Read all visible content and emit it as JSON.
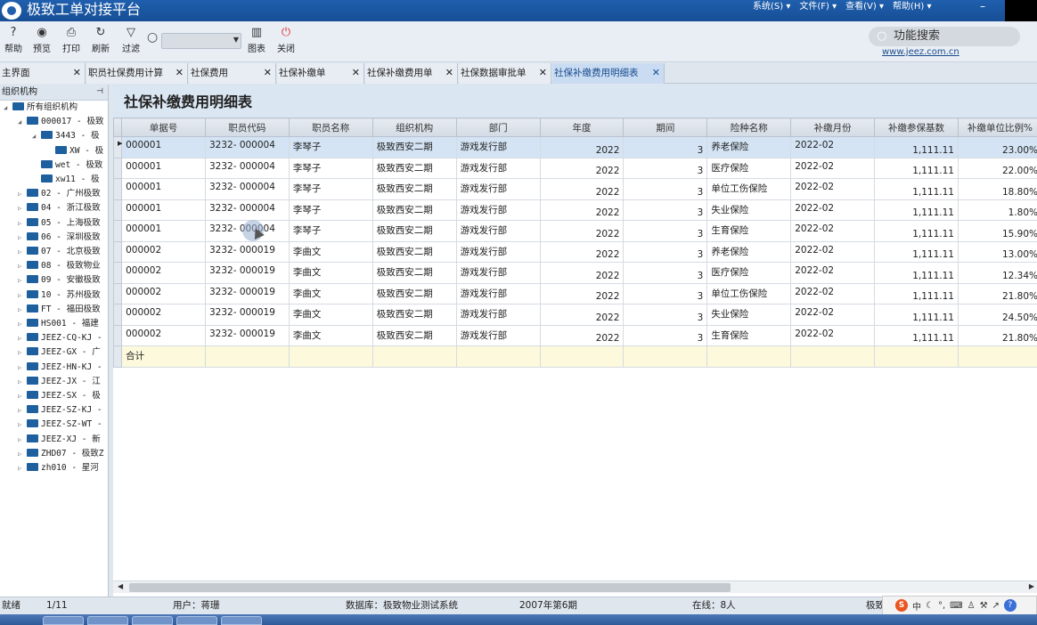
{
  "app": {
    "title": "极致工单对接平台",
    "menus": [
      "系统(S)",
      "文件(F)",
      "查看(V)",
      "帮助(H)"
    ],
    "website": "www.jeez.com.cn",
    "search_label": "功能搜索"
  },
  "toolbar": {
    "help": "帮助",
    "preview": "预览",
    "print": "打印",
    "refresh": "刷新",
    "filter": "过滤",
    "chart": "图表",
    "close": "关闭",
    "search_value": ""
  },
  "tabs": [
    "主界面",
    "职员社保费用计算",
    "社保费用",
    "社保补缴单",
    "社保补缴费用单",
    "社保数据审批单",
    "社保补缴费用明细表"
  ],
  "sidebar": {
    "title": "组织机构",
    "nodes": [
      "所有组织机构",
      "000017 - 极致",
      "3443 - 极",
      "XW - 极",
      "wet - 极致",
      "xw11 - 极",
      "02 - 广州极致",
      "04 - 浙江极致",
      "05 - 上海极致",
      "06 - 深圳极致",
      "07 - 北京极致",
      "08 - 极致物业",
      "09 - 安徽极致",
      "10 - 苏州极致",
      "FT - 福田极致",
      "HS001 - 福建",
      "JEEZ-CQ-KJ -",
      "JEEZ-GX - 广",
      "JEEZ-HN-KJ -",
      "JEEZ-JX - 江",
      "JEEZ-SX - 极",
      "JEEZ-SZ-KJ -",
      "JEEZ-SZ-WT -",
      "JEEZ-XJ - 新",
      "ZHD07 - 极致Z",
      "zh010 - 星河"
    ]
  },
  "report": {
    "title": "社保补缴费用明细表",
    "columns": [
      "单据号",
      "职员代码",
      "职员名称",
      "组织机构",
      "部门",
      "年度",
      "期间",
      "险种名称",
      "补缴月份",
      "补缴参保基数",
      "补缴单位比例%"
    ],
    "rows": [
      [
        "000001",
        "3232- 000004",
        "李琴子",
        "极致西安二期",
        "游戏发行部",
        "2022",
        "3",
        "养老保险",
        "2022-02",
        "1,111.11",
        "23.00%"
      ],
      [
        "000001",
        "3232- 000004",
        "李琴子",
        "极致西安二期",
        "游戏发行部",
        "2022",
        "3",
        "医疗保险",
        "2022-02",
        "1,111.11",
        "22.00%"
      ],
      [
        "000001",
        "3232- 000004",
        "李琴子",
        "极致西安二期",
        "游戏发行部",
        "2022",
        "3",
        "单位工伤保险",
        "2022-02",
        "1,111.11",
        "18.80%"
      ],
      [
        "000001",
        "3232- 000004",
        "李琴子",
        "极致西安二期",
        "游戏发行部",
        "2022",
        "3",
        "失业保险",
        "2022-02",
        "1,111.11",
        "1.80%"
      ],
      [
        "000001",
        "3232- 000004",
        "李琴子",
        "极致西安二期",
        "游戏发行部",
        "2022",
        "3",
        "生育保险",
        "2022-02",
        "1,111.11",
        "15.90%"
      ],
      [
        "000002",
        "3232- 000019",
        "李曲文",
        "极致西安二期",
        "游戏发行部",
        "2022",
        "3",
        "养老保险",
        "2022-02",
        "1,111.11",
        "13.00%"
      ],
      [
        "000002",
        "3232- 000019",
        "李曲文",
        "极致西安二期",
        "游戏发行部",
        "2022",
        "3",
        "医疗保险",
        "2022-02",
        "1,111.11",
        "12.34%"
      ],
      [
        "000002",
        "3232- 000019",
        "李曲文",
        "极致西安二期",
        "游戏发行部",
        "2022",
        "3",
        "单位工伤保险",
        "2022-02",
        "1,111.11",
        "21.80%"
      ],
      [
        "000002",
        "3232- 000019",
        "李曲文",
        "极致西安二期",
        "游戏发行部",
        "2022",
        "3",
        "失业保险",
        "2022-02",
        "1,111.11",
        "24.50%"
      ],
      [
        "000002",
        "3232- 000019",
        "李曲文",
        "极致西安二期",
        "游戏发行部",
        "2022",
        "3",
        "生育保险",
        "2022-02",
        "1,111.11",
        "21.80%"
      ]
    ],
    "total_label": "合计"
  },
  "status": {
    "state": "就绪",
    "page": "1/11",
    "user": "用户：蒋珊",
    "database": "数据库：极致物业测试系统",
    "period": "2007年第6期",
    "online": "在线：8人",
    "org": "极致"
  },
  "ime": {
    "lang": "中"
  }
}
